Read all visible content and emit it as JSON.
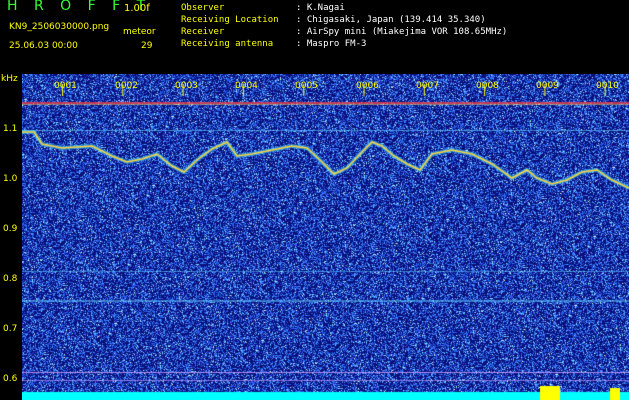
{
  "header": {
    "brand": "H R O F F T",
    "version": "1.00f",
    "filename": "KN9_2506030000.png",
    "meteor_label": "meteor",
    "timestamp": "25.06.03 00:00",
    "meteor_count": "29",
    "meta": [
      {
        "key": "Observer",
        "value": ": K.Nagai"
      },
      {
        "key": "Receiving Location",
        "value": ": Chigasaki, Japan (139.414 35.340)"
      },
      {
        "key": "Receiver",
        "value": ": AirSpy mini (Miakejima VOR 108.65MHz)"
      },
      {
        "key": "Receiving antenna",
        "value": ": Maspro FM-3"
      }
    ]
  },
  "spectrogram": {
    "unit_label": "kHz",
    "time_ticks": [
      "0001",
      "0002",
      "0003",
      "0004",
      "0005",
      "0006",
      "0007",
      "0008",
      "0009",
      "0010"
    ],
    "freq_ticks": [
      "1.1",
      "1.0",
      "0.9",
      "0.8",
      "0.7",
      "0.6"
    ],
    "colors": {
      "background": "#0a0f7a",
      "noise": "#2f6dff",
      "trace": "#ffd23a",
      "carrier": "#ff3a3a"
    }
  }
}
